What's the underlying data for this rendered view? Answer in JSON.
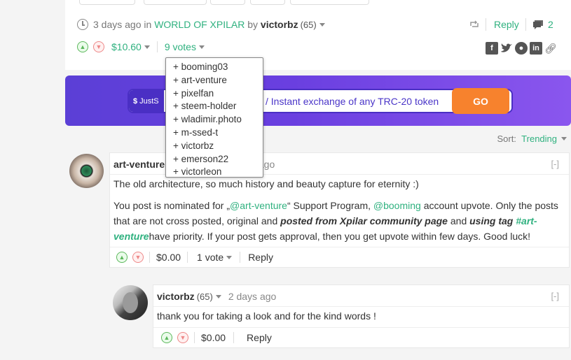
{
  "post": {
    "age": "3 days ago",
    "in_word": "in",
    "community": "WORLD OF XPILAR",
    "by_word": "by",
    "author": "victorbz",
    "reputation": "(65)",
    "reply_label": "Reply",
    "comment_count": "2",
    "payout": "$10.60",
    "votes_label": "9 votes",
    "voters": [
      "+ booming03",
      "+ art-venture",
      "+ pixelfan",
      "+ steem-holder",
      "+ wladimir.photo",
      "+ m-ssed-t",
      "+ victorbz",
      "+ emerson22",
      "+ victorleon"
    ]
  },
  "banner": {
    "badge": "JustS",
    "text": "/ Instant exchange of any TRC-20 token",
    "button": "GO"
  },
  "sort": {
    "label": "Sort:",
    "value": "Trending"
  },
  "comments": [
    {
      "author": "art-venture",
      "age": "ys ago",
      "collapse": "[-]",
      "paragraph1": "The old architecture, so much history and beauty capture for eternity :)",
      "p2_a": "You post is nominated for „",
      "p2_mention": "@art-venture",
      "p2_b": "“ Support Program, ",
      "p2_mention2": "@booming",
      "p2_c": " account upvote. Only the posts that are not cross posted, original and ",
      "p2_bold1": "posted from Xpilar community page",
      "p2_d": " and ",
      "p2_bold2": "using tag ",
      "p2_tag": "#art-venture",
      "p2_e": "have priority. If your post gets approval, then you get upvote within few days. Good luck!",
      "payout": "$0.00",
      "votes": "1 vote",
      "reply": "Reply"
    },
    {
      "author": "victorbz",
      "reputation": "(65)",
      "age": "2 days ago",
      "collapse": "[-]",
      "text": "thank you for taking a look and for the kind words !",
      "payout": "$0.00",
      "reply": "Reply"
    }
  ],
  "colors": {
    "accent": "#2fb17f",
    "banner": "#6a3fe0",
    "go": "#f7822d"
  }
}
